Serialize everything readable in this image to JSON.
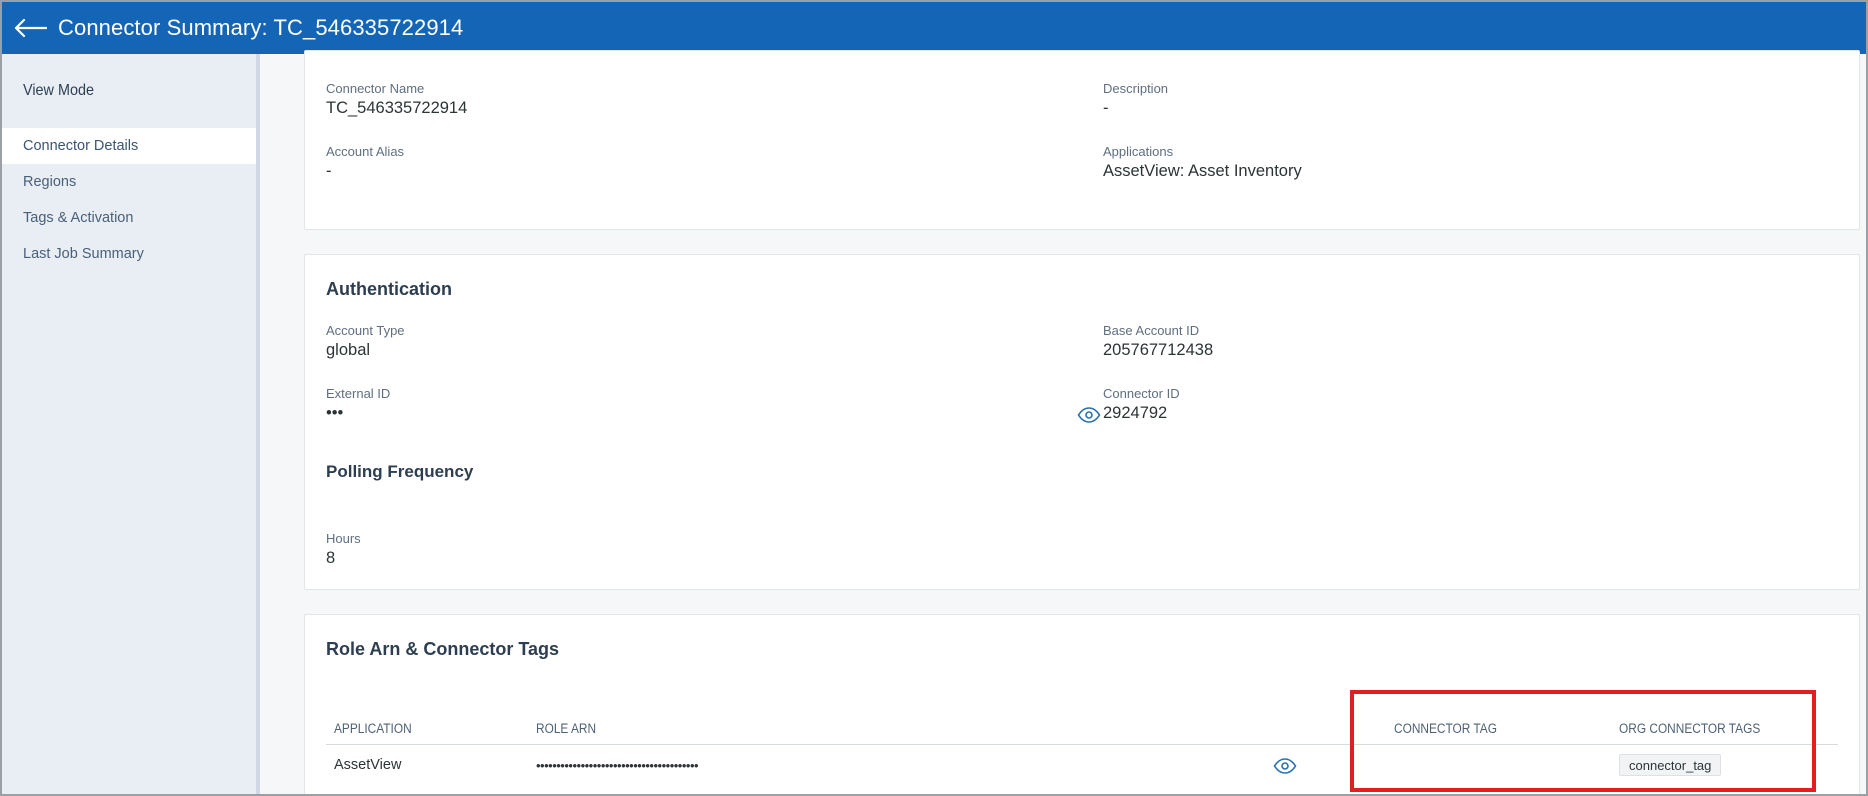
{
  "header": {
    "title": "Connector Summary: TC_546335722914"
  },
  "sidebar": {
    "title": "View Mode",
    "items": [
      {
        "label": "Connector Details",
        "active": true
      },
      {
        "label": "Regions",
        "active": false
      },
      {
        "label": "Tags & Activation",
        "active": false
      },
      {
        "label": "Last Job Summary",
        "active": false
      }
    ]
  },
  "details": {
    "connector_name_label": "Connector Name",
    "connector_name": "TC_546335722914",
    "description_label": "Description",
    "description": "-",
    "account_alias_label": "Account Alias",
    "account_alias": "-",
    "applications_label": "Applications",
    "applications": "AssetView: Asset Inventory"
  },
  "authentication": {
    "title": "Authentication",
    "account_type_label": "Account Type",
    "account_type": "global",
    "base_account_id_label": "Base Account ID",
    "base_account_id": "205767712438",
    "external_id_label": "External ID",
    "external_id": "•••",
    "connector_id_label": "Connector ID",
    "connector_id": "2924792",
    "polling_title": "Polling Frequency",
    "hours_label": "Hours",
    "hours": "8"
  },
  "role_arn": {
    "title": "Role Arn & Connector Tags",
    "columns": [
      "APPLICATION",
      "ROLE ARN",
      "CONNECTOR TAG",
      "ORG CONNECTOR TAGS"
    ],
    "rows": [
      {
        "application": "AssetView",
        "role_arn": "••••••••••••••••••••••••••••••••••••••••",
        "connector_tag": "",
        "org_connector_tag": "connector_tag"
      }
    ]
  },
  "colors": {
    "header_bg": "#1565b7",
    "highlight": "#e02020",
    "eye_icon": "#2a6fb0"
  }
}
